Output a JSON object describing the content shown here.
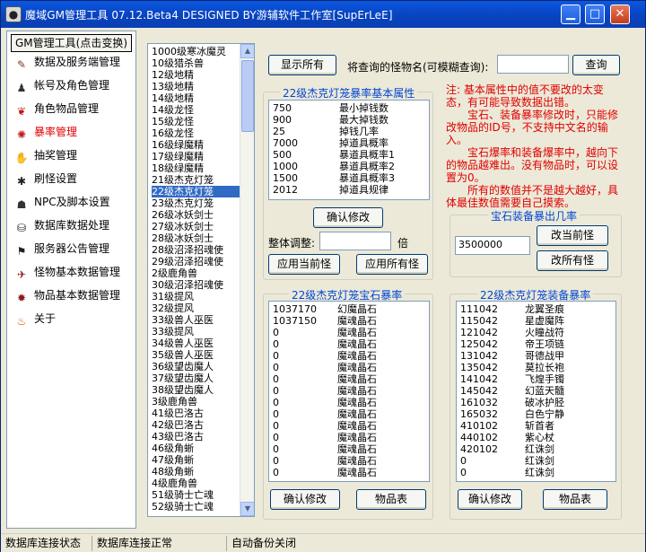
{
  "window": {
    "title": "魔域GM管理工具 07.12.Beta4 DESIGNED BY游辅软件工作室[SupErLeE]",
    "app_icon": "panda-icon"
  },
  "nav": {
    "header": "GM管理工具(点击变换)",
    "items": [
      {
        "label": "数据及服务端管理",
        "icon": "pen-icon"
      },
      {
        "label": "帐号及角色管理",
        "icon": "character-icon"
      },
      {
        "label": "角色物品管理",
        "icon": "chili-icon"
      },
      {
        "label": "暴率管理",
        "icon": "monster-icon"
      },
      {
        "label": "抽奖管理",
        "icon": "hand-icon"
      },
      {
        "label": "刷怪设置",
        "icon": "beetle-icon"
      },
      {
        "label": "NPC及脚本设置",
        "icon": "npc-icon"
      },
      {
        "label": "数据库数据处理",
        "icon": "database-icon"
      },
      {
        "label": "服务器公告管理",
        "icon": "flag-icon"
      },
      {
        "label": "怪物基本数据管理",
        "icon": "wing-icon"
      },
      {
        "label": "物品基本数据管理",
        "icon": "spider-icon"
      },
      {
        "label": "关于",
        "icon": "flame-icon"
      }
    ],
    "active_index": 3
  },
  "monster_list": {
    "items": [
      "1000级寒冰魔灵",
      "10级猎杀兽",
      "12级地精",
      "13级地精",
      "14级地精",
      "14级龙怪",
      "15级龙怪",
      "16级龙怪",
      "16级绿魔精",
      "17级绿魔精",
      "18级绿魔精",
      "21级杰克灯笼",
      "22级杰克灯笼",
      "23级杰克灯笼",
      "26级冰妖剑士",
      "27级冰妖剑士",
      "28级冰妖剑士",
      "28级沼泽招魂使",
      "29级沼泽招魂使",
      "2级鹿角兽",
      "30级沼泽招魂使",
      "31级提风",
      "32级提风",
      "33级兽人巫医",
      "33级提风",
      "34级兽人巫医",
      "35级兽人巫医",
      "36级望齿魔人",
      "37级望齿魔人",
      "38级望齿魔人",
      "3级鹿角兽",
      "41级巴洛古",
      "42级巴洛古",
      "43级巴洛古",
      "46级角蜥",
      "47级角蜥",
      "48级角蜥",
      "4级鹿角兽",
      "51级骑士亡魂",
      "52级骑士亡魂"
    ],
    "selected_index": 12
  },
  "search": {
    "show_all_label": "显示所有",
    "query_label": "将查询的怪物名(可模糊查询):",
    "input_value": "",
    "query_button": "查询"
  },
  "basic_attrs": {
    "title": "22级杰克灯笼暴率基本属性",
    "rows": [
      {
        "value": "750",
        "name": "最小掉钱数"
      },
      {
        "value": "900",
        "name": "最大掉钱数"
      },
      {
        "value": "25",
        "name": "掉钱几率"
      },
      {
        "value": "7000",
        "name": "掉道具概率"
      },
      {
        "value": "500",
        "name": "暴道具概率1"
      },
      {
        "value": "1000",
        "name": "暴道具概率2"
      },
      {
        "value": "1500",
        "name": "暴道具概率3"
      },
      {
        "value": "2012",
        "name": "掉道具规律"
      }
    ],
    "confirm_label": "确认修改",
    "adjust_label": "整体调整:",
    "adjust_value": "",
    "adjust_unit": "倍",
    "apply_current": "应用当前怪",
    "apply_all": "应用所有怪"
  },
  "note": {
    "paragraphs": [
      "注: 基本属性中的值不要改的太变态，有可能导致数据出错。",
      "宝石、装备暴率修改时，只能修改物品的ID号，不支持中文名的输入。",
      "宝石爆率和装备爆率中，越向下的物品越难出。没有物品时，可以设置为0。",
      "所有的数值并不是越大越好，具体最佳数值需要自己摸索。"
    ]
  },
  "gem_rate": {
    "title": "宝石装备暴出几率",
    "value": "3500000",
    "change_current": "改当前怪",
    "change_all": "改所有怪"
  },
  "gem_drops": {
    "title": "22级杰克灯笼宝石暴率",
    "rows": [
      {
        "id": "1037170",
        "name": "幻魔晶石"
      },
      {
        "id": "1037150",
        "name": "魔魂晶石"
      },
      {
        "id": "0",
        "name": "魔魂晶石"
      },
      {
        "id": "0",
        "name": "魔魂晶石"
      },
      {
        "id": "0",
        "name": "魔魂晶石"
      },
      {
        "id": "0",
        "name": "魔魂晶石"
      },
      {
        "id": "0",
        "name": "魔魂晶石"
      },
      {
        "id": "0",
        "name": "魔魂晶石"
      },
      {
        "id": "0",
        "name": "魔魂晶石"
      },
      {
        "id": "0",
        "name": "魔魂晶石"
      },
      {
        "id": "0",
        "name": "魔魂晶石"
      },
      {
        "id": "0",
        "name": "魔魂晶石"
      },
      {
        "id": "0",
        "name": "魔魂晶石"
      },
      {
        "id": "0",
        "name": "魔魂晶石"
      },
      {
        "id": "0",
        "name": "魔魂晶石"
      }
    ],
    "confirm_label": "确认修改",
    "items_label": "物品表"
  },
  "equip_drops": {
    "title": "22级杰克灯笼装备暴率",
    "rows": [
      {
        "id": "111042",
        "name": "龙翼圣痕"
      },
      {
        "id": "115042",
        "name": "星虚魔阵"
      },
      {
        "id": "121042",
        "name": "火瞳战符"
      },
      {
        "id": "125042",
        "name": "帝王项链"
      },
      {
        "id": "131042",
        "name": "哥德战甲"
      },
      {
        "id": "135042",
        "name": "莫拉长袍"
      },
      {
        "id": "141042",
        "name": "飞煌手镯"
      },
      {
        "id": "145042",
        "name": "幻蓝天髓"
      },
      {
        "id": "161032",
        "name": "破冰护胫"
      },
      {
        "id": "165032",
        "name": "白色宁静"
      },
      {
        "id": "410102",
        "name": "斩首者"
      },
      {
        "id": "440102",
        "name": "紫心杖"
      },
      {
        "id": "420102",
        "name": "红诛剑"
      },
      {
        "id": "0",
        "name": "红诛剑"
      },
      {
        "id": "0",
        "name": "红诛剑"
      }
    ],
    "confirm_label": "确认修改",
    "items_label": "物品表"
  },
  "status": {
    "cell1": "数据库连接状态",
    "cell2": "数据库连接正常",
    "cell3": "自动备份关闭"
  }
}
